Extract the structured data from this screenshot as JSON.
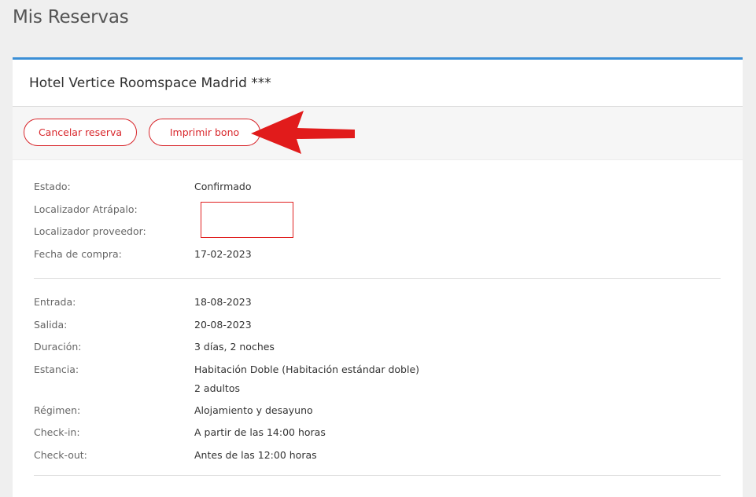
{
  "page": {
    "title": "Mis Reservas"
  },
  "booking": {
    "hotel_name": "Hotel Vertice Roomspace Madrid ***",
    "actions": {
      "cancel_label": "Cancelar reserva",
      "print_label": "Imprimir bono"
    },
    "status_section": [
      {
        "label": "Estado:",
        "value": "Confirmado"
      },
      {
        "label": "Localizador Atrápalo:",
        "value": ""
      },
      {
        "label": "Localizador proveedor:",
        "value": ""
      },
      {
        "label": "Fecha de compra:",
        "value": "17-02-2023"
      }
    ],
    "stay_section": {
      "entrada": {
        "label": "Entrada:",
        "value": "18-08-2023"
      },
      "salida": {
        "label": "Salida:",
        "value": "20-08-2023"
      },
      "duracion": {
        "label": "Duración:",
        "value": "3 días, 2 noches"
      },
      "estancia": {
        "label": "Estancia:",
        "value_line1": "Habitación Doble (Habitación estándar doble)",
        "value_line2": "2 adultos"
      },
      "regimen": {
        "label": "Régimen:",
        "value": "Alojamiento y desayuno"
      },
      "checkin": {
        "label": "Check-in:",
        "value": "A partir de las 14:00 horas"
      },
      "checkout": {
        "label": "Check-out:",
        "value": "Antes de las 12:00 horas"
      }
    }
  },
  "colors": {
    "accent_blue": "#3b8fd6",
    "brand_red": "#d8262b",
    "annotation_red": "#e02020"
  }
}
